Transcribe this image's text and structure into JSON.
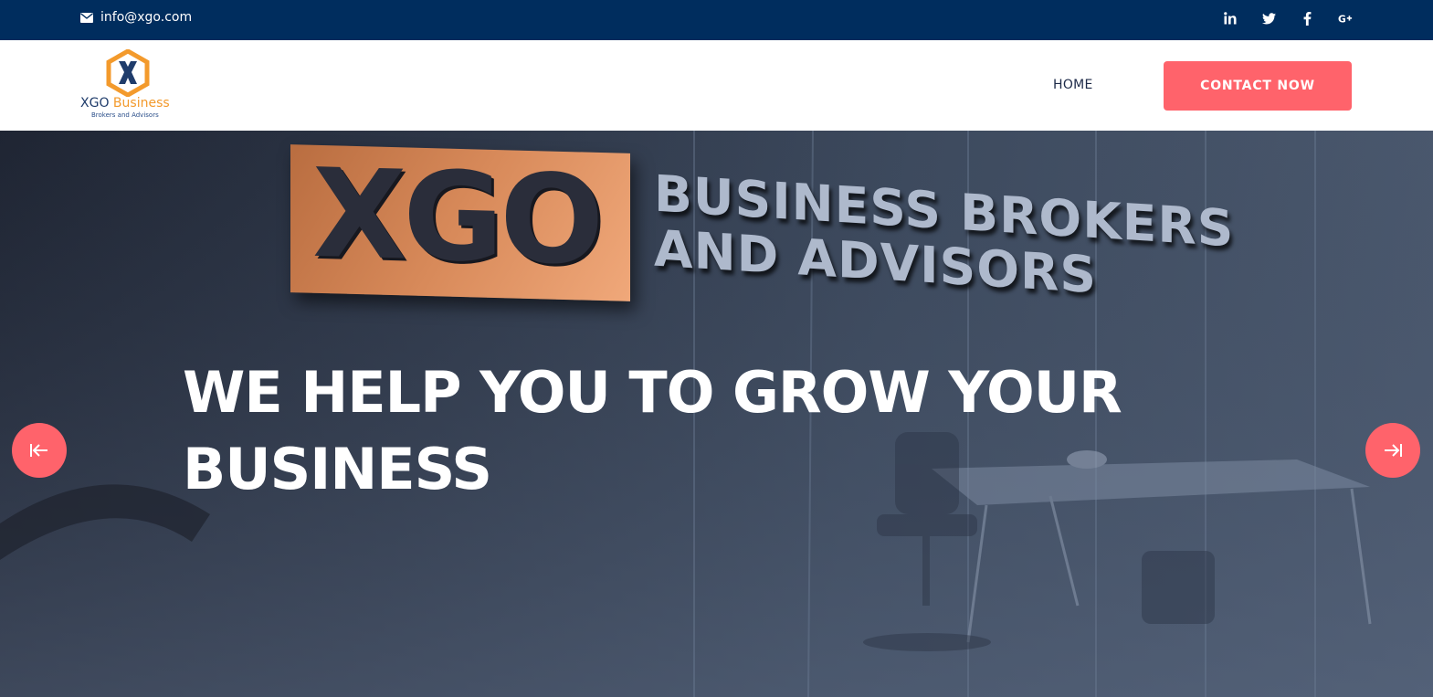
{
  "topbar": {
    "email": "info@xgo.com",
    "socials": [
      {
        "icon": "linkedin-icon",
        "glyph": "in"
      },
      {
        "icon": "twitter-icon",
        "glyph": "🐦"
      },
      {
        "icon": "facebook-icon",
        "glyph": "f"
      },
      {
        "icon": "google-plus-icon",
        "glyph": "G+"
      }
    ]
  },
  "header": {
    "logo": {
      "brand_main": "XGO",
      "brand_accent": "Business",
      "tagline": "Brokers and Advisors"
    },
    "nav": {
      "home": "HOME"
    },
    "contact_button": "CONTACT NOW"
  },
  "hero": {
    "sign": {
      "plate": "XGO",
      "line1": "BUSINESS BROKERS",
      "line2": "AND ADVISORS"
    },
    "headline_line1": "WE HELP YOU TO GROW YOUR",
    "headline_line2": "BUSINESS"
  },
  "colors": {
    "topbar": "#002d5e",
    "accent": "#ff636b",
    "logo_orange": "#f39a2c",
    "logo_navy": "#1f3c6b"
  }
}
